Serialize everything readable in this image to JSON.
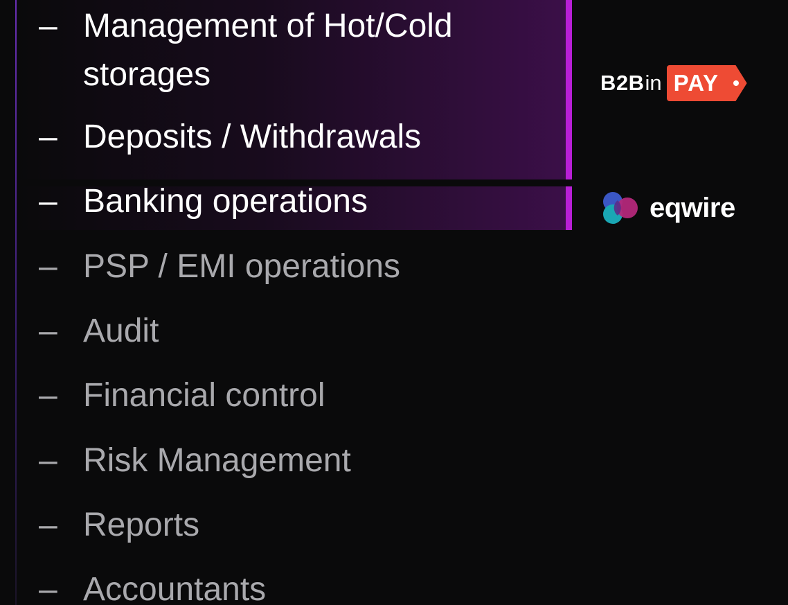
{
  "menu": {
    "items": [
      {
        "dash": "–",
        "label": "Management of Hot/Cold storages"
      },
      {
        "dash": "–",
        "label": "Deposits / Withdrawals"
      },
      {
        "dash": "–",
        "label": "Banking operations"
      },
      {
        "dash": "–",
        "label": "PSP / EMI operations"
      },
      {
        "dash": "–",
        "label": "Audit"
      },
      {
        "dash": "–",
        "label": "Financial control"
      },
      {
        "dash": "–",
        "label": "Risk Management"
      },
      {
        "dash": "–",
        "label": "Reports"
      },
      {
        "dash": "–",
        "label": "Accountants"
      }
    ]
  },
  "logos": {
    "b2binpay": {
      "b2b": "B2B",
      "in": "in",
      "pay": "PAY",
      "icon": "b2binpay-logo"
    },
    "eqwire": {
      "name": "eqwire",
      "icon": "eqwire-logo"
    }
  },
  "colors": {
    "background": "#0a0a0b",
    "accent": "#b81fd6",
    "highlight_fill": "#3b0f48",
    "text_active": "#ffffff",
    "text_muted": "#a9a9ad",
    "pay_red": "#ee4b34"
  }
}
